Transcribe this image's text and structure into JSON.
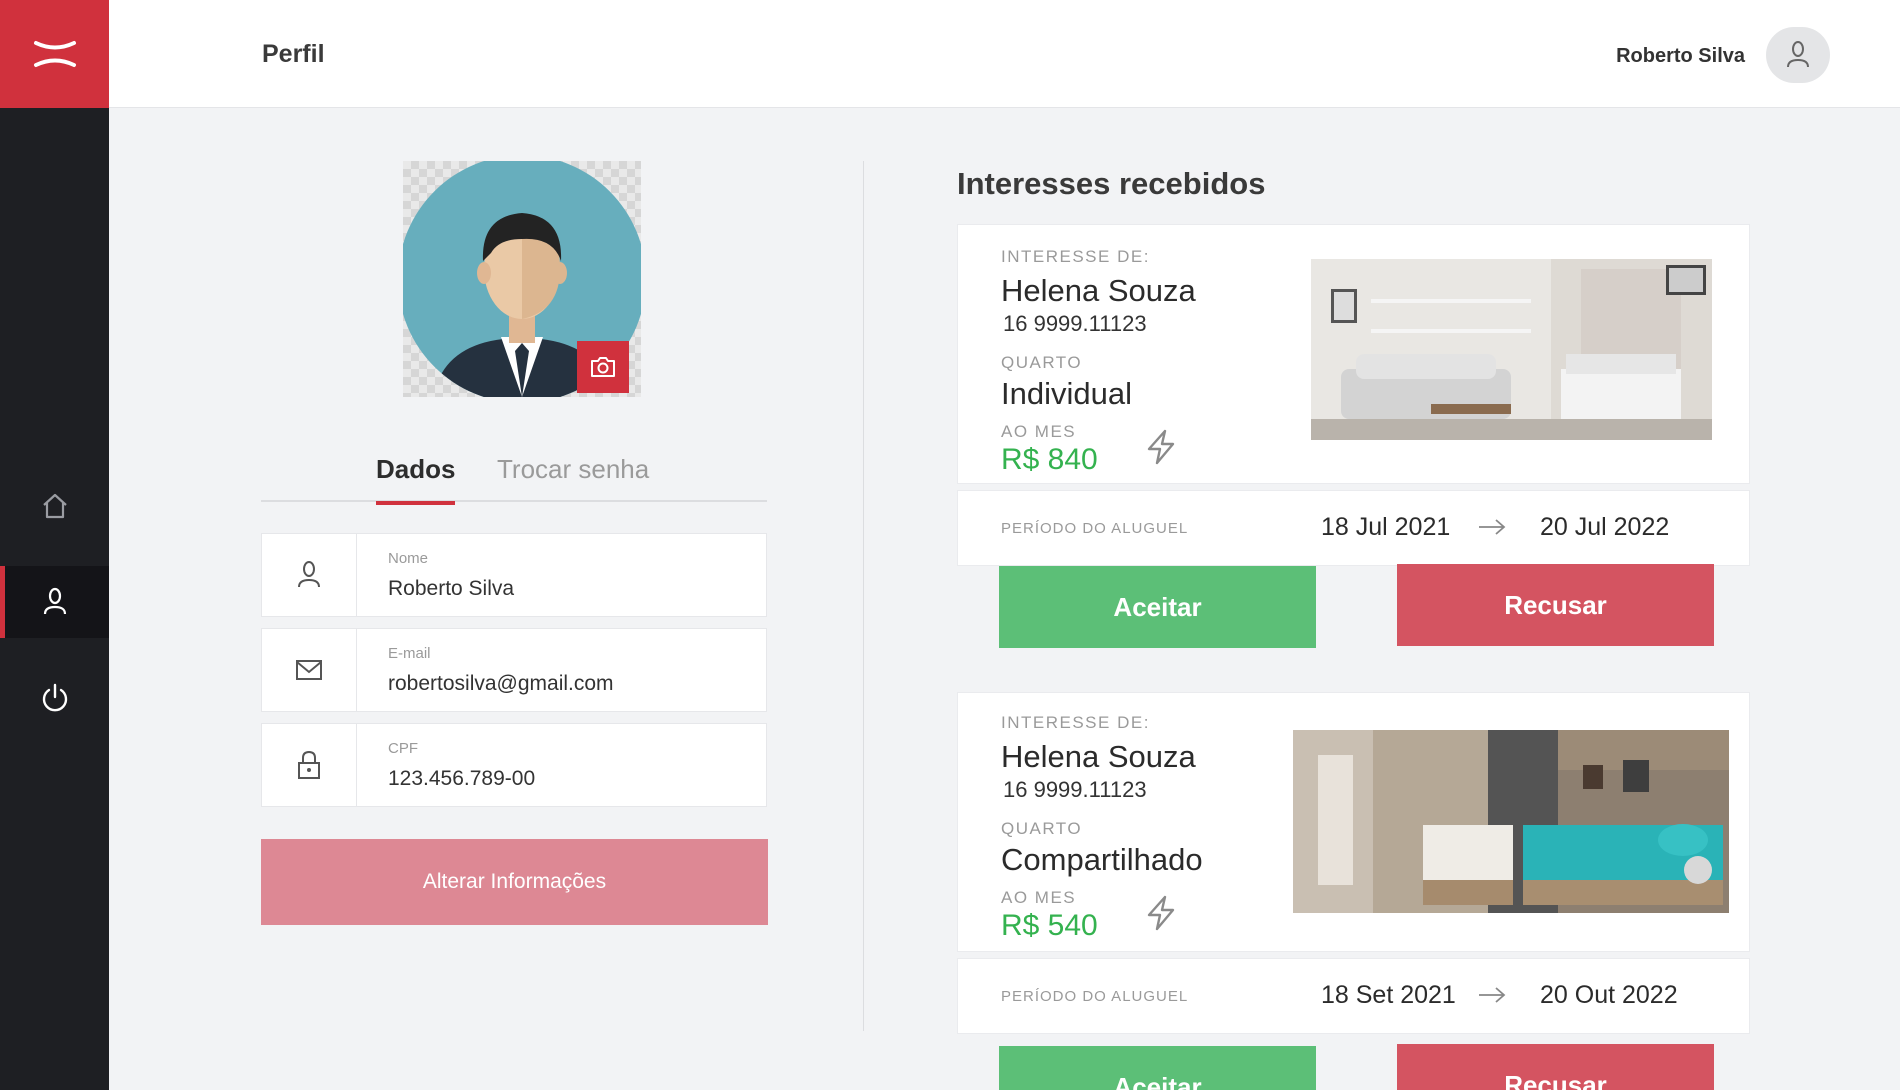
{
  "header": {
    "title": "Perfil",
    "user_name": "Roberto Silva"
  },
  "sidebar": {
    "items": [
      {
        "name": "home",
        "icon": "home-icon"
      },
      {
        "name": "profile",
        "icon": "user-icon"
      },
      {
        "name": "logout",
        "icon": "power-icon"
      }
    ]
  },
  "profile": {
    "tabs": {
      "dados": "Dados",
      "trocar_senha": "Trocar senha"
    },
    "fields": [
      {
        "label": "Nome",
        "value": "Roberto Silva",
        "icon": "user-icon"
      },
      {
        "label": "E-mail",
        "value": "robertosilva@gmail.com",
        "icon": "mail-icon"
      },
      {
        "label": "CPF",
        "value": "123.456.789-00",
        "icon": "lock-icon"
      }
    ],
    "update_button": "Alterar Informações"
  },
  "interests": {
    "title": "Interesses recebidos",
    "items": [
      {
        "from_label": "INTERESSE DE:",
        "name": "Helena Souza",
        "phone": "16 9999.11123",
        "room_label": "QUARTO",
        "room": "Individual",
        "month_label": "AO MES",
        "price": "R$ 840",
        "period_label": "PERÍODO DO ALUGUEL",
        "start": "18 Jul 2021",
        "end": "20 Jul 2022",
        "accept": "Aceitar",
        "refuse": "Recusar"
      },
      {
        "from_label": "INTERESSE DE:",
        "name": "Helena Souza",
        "phone": "16 9999.11123",
        "room_label": "QUARTO",
        "room": "Compartilhado",
        "month_label": "AO MES",
        "price": "R$ 540",
        "period_label": "PERÍODO DO ALUGUEL",
        "start": "18 Set 2021",
        "end": "20 Out 2022",
        "accept": "Aceitar",
        "refuse": "Recusar"
      }
    ]
  },
  "colors": {
    "brand": "#d0313d",
    "sidebar": "#1e1f23",
    "accept": "#5cbf77",
    "refuse": "#d45461",
    "price": "#34b24f"
  }
}
